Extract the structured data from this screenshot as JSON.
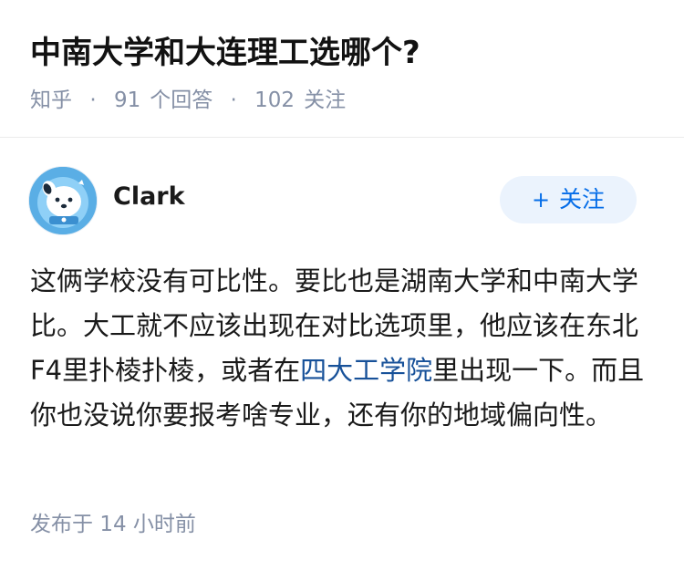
{
  "question": {
    "title": "中南大学和大连理工选哪个?",
    "source": "知乎",
    "separator": "·",
    "answer_count": "91",
    "answer_label": "个回答",
    "follower_count": "102",
    "follower_label": "关注"
  },
  "author": {
    "name": "Clark",
    "avatar_icon": "cartoon-dog-avatar-icon"
  },
  "follow_button": {
    "icon": "+",
    "label": "关注"
  },
  "answer": {
    "text_before_link": "这俩学校没有可比性。要比也是湖南大学和中南大学比。大工就不应该出现在对比选项里，他应该在东北F4里扑棱扑棱，或者在",
    "link_text": "四大工学院",
    "text_after_link": "里出现一下。而且你也没说你要报考啥专业，还有你的地域偏向性。"
  },
  "footer": {
    "published_label": "发布于",
    "published_time": "14 小时前"
  },
  "colors": {
    "link": "#175199",
    "follow_button_bg": "#ebf3fd",
    "follow_button_text": "#056de8",
    "meta_text": "#8590a6"
  }
}
